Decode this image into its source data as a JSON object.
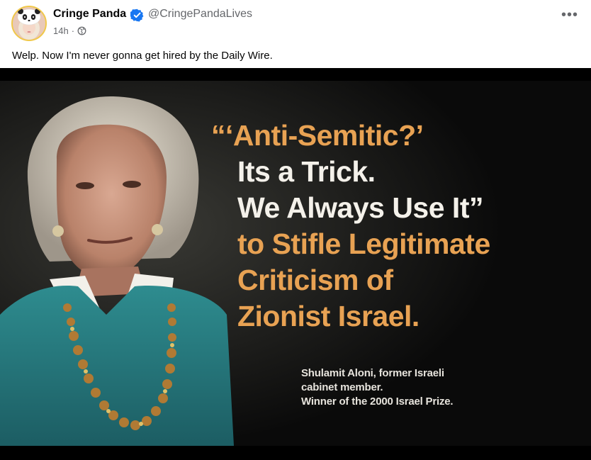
{
  "post": {
    "author_name": "Cringe Panda",
    "handle": "@CringePandaLives",
    "time": "14h",
    "separator": "·",
    "caption": "Welp. Now I'm never gonna get hired by the Daily Wire.",
    "more_label": "•••"
  },
  "image": {
    "quote_lines": [
      "“‘Anti-Semitic?’",
      "Its a Trick.",
      "We Always Use It”",
      "to Stifle Legitimate",
      "Criticism of",
      "Zionist Israel."
    ],
    "credit_lines": [
      "Shulamit Aloni, former Israeli",
      "cabinet member.",
      "Winner of the 2000 Israel Prize."
    ]
  },
  "colors": {
    "verified_badge": "#1877f2",
    "quote_accent": "#e8a253",
    "quote_white": "#f4f1ea",
    "secondary_text": "#65676b"
  },
  "icons": {
    "verified": "verified-badge-icon",
    "audience": "globe-icon",
    "menu": "more-options-icon"
  }
}
